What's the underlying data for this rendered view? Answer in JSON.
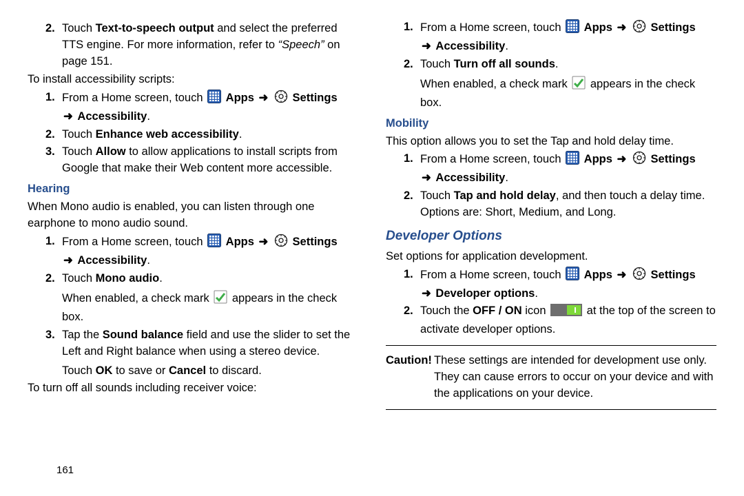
{
  "left": {
    "step2_top": {
      "num": "2.",
      "pre": "Touch ",
      "b1": "Text-to-speech output",
      "mid": " and select the preferred TTS engine. For more information, refer to ",
      "ref": "“Speech”",
      "post": " on page 151."
    },
    "install_intro": "To install accessibility scripts:",
    "install": {
      "s1": {
        "num": "1.",
        "pre": "From a Home screen, touch ",
        "apps": "Apps",
        "settings": "Settings",
        "accessibility": "Accessibility",
        "dot": "."
      },
      "s2": {
        "num": "2.",
        "pre": "Touch ",
        "b": "Enhance web accessibility",
        "post": "."
      },
      "s3": {
        "num": "3.",
        "pre": "Touch ",
        "b": "Allow",
        "post": " to allow applications to install scripts from Google that make their Web content more accessible."
      }
    },
    "hearing_title": "Hearing",
    "hearing_intro": "When Mono audio is enabled, you can listen through one earphone to mono audio sound.",
    "hearing": {
      "s1": {
        "num": "1.",
        "pre": "From a Home screen, touch ",
        "apps": "Apps",
        "settings": "Settings",
        "accessibility": "Accessibility",
        "dot": "."
      },
      "s2": {
        "num": "2.",
        "pre": "Touch ",
        "b": "Mono audio",
        "post": ".",
        "enabled_pre": "When enabled, a check mark ",
        "enabled_post": " appears in the check box."
      },
      "s3": {
        "num": "3.",
        "pre": "Tap the ",
        "b1": "Sound balance",
        "mid": " field and use the slider to set the Left and Right balance when using a stereo device.",
        "line2_pre": "Touch ",
        "ok": "OK",
        "line2_mid": " to save or ",
        "cancel": "Cancel",
        "line2_post": " to discard."
      }
    },
    "turnoff_intro": "To turn off all sounds including receiver voice:"
  },
  "right": {
    "top": {
      "s1": {
        "num": "1.",
        "pre": "From a Home screen, touch ",
        "apps": "Apps",
        "settings": "Settings",
        "accessibility": "Accessibility",
        "dot": "."
      },
      "s2": {
        "num": "2.",
        "pre": "Touch ",
        "b": "Turn off all sounds",
        "post": ".",
        "enabled_pre": "When enabled, a check mark ",
        "enabled_post": " appears in the check box."
      }
    },
    "mobility_title": "Mobility",
    "mobility_intro": "This option allows you to set the Tap and hold delay time.",
    "mobility": {
      "s1": {
        "num": "1.",
        "pre": "From a Home screen, touch ",
        "apps": "Apps",
        "settings": "Settings",
        "accessibility": "Accessibility",
        "dot": "."
      },
      "s2": {
        "num": "2.",
        "pre": "Touch ",
        "b": "Tap and hold delay",
        "post": ", and then touch a delay time. Options are: Short, Medium, and Long."
      }
    },
    "dev_title": "Developer Options",
    "dev_intro": "Set options for application development.",
    "dev": {
      "s1": {
        "num": "1.",
        "pre": "From a Home screen, touch ",
        "apps": "Apps",
        "settings": "Settings",
        "devopt": "Developer options",
        "dot": "."
      },
      "s2": {
        "num": "2.",
        "pre": "Touch the ",
        "b": "OFF / ON",
        "mid": " icon ",
        "post": " at the top of the screen to activate developer options."
      }
    },
    "caution_label": "Caution!",
    "caution_text": "These settings are intended for development use only. They can cause errors to occur on your device and with the applications on your device."
  },
  "page_number": "161",
  "arrow_char": "➜"
}
